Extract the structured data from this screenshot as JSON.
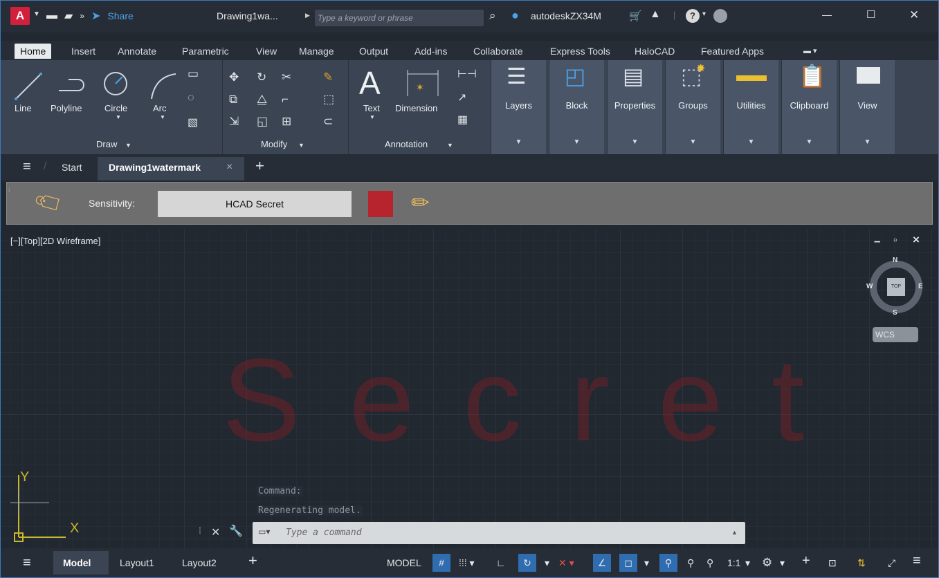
{
  "titlebar": {
    "logo": "A",
    "share": "Share",
    "doc_title": "Drawing1wa...",
    "search_placeholder": "Type a keyword or phrase",
    "user": "autodeskZX34M",
    "minimize": "—",
    "maximize": "☐",
    "close": "✕"
  },
  "ribbon_tabs": [
    "Home",
    "Insert",
    "Annotate",
    "Parametric",
    "View",
    "Manage",
    "Output",
    "Add-ins",
    "Collaborate",
    "Express Tools",
    "HaloCAD",
    "Featured Apps"
  ],
  "draw": {
    "line": "Line",
    "polyline": "Polyline",
    "circle": "Circle",
    "arc": "Arc",
    "group": "Draw"
  },
  "modify": {
    "group": "Modify"
  },
  "annotation": {
    "text": "Text",
    "dimension": "Dimension",
    "group": "Annotation"
  },
  "panels": [
    "Layers",
    "Block",
    "Properties",
    "Groups",
    "Utilities",
    "Clipboard",
    "View"
  ],
  "doc_tabs": {
    "start": "Start",
    "drawing": "Drawing1watermark",
    "close": "×",
    "add": "+"
  },
  "sensitivity": {
    "label": "Sensitivity:",
    "value": "HCAD Secret",
    "color": "#b8242d"
  },
  "viewport": {
    "label": "[−][Top][2D Wireframe]",
    "watermark": "Secret",
    "viewcube": {
      "n": "N",
      "s": "S",
      "e": "E",
      "w": "W",
      "top": "TOP",
      "wcs": "WCS"
    },
    "ucs": {
      "x": "X",
      "y": "Y"
    },
    "controls": {
      "min": "–",
      "restore": "▫",
      "close": "×"
    }
  },
  "command": {
    "history": [
      "Command:",
      "Regenerating model."
    ],
    "placeholder": "Type a command"
  },
  "statusbar": {
    "layout_tabs": [
      "Model",
      "Layout1",
      "Layout2"
    ],
    "add": "+",
    "model": "MODEL",
    "scale": "1:1"
  }
}
